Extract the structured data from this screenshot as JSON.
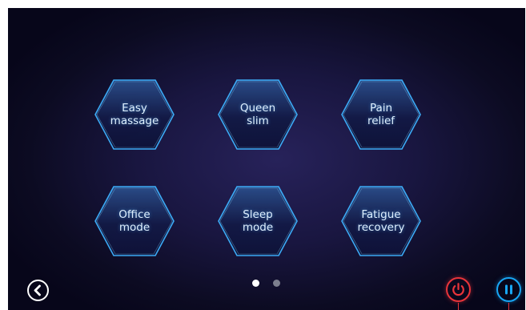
{
  "modes": [
    {
      "id": "easy-massage",
      "label": "Easy\nmassage"
    },
    {
      "id": "queen-slim",
      "label": "Queen\nslim"
    },
    {
      "id": "pain-relief",
      "label": "Pain\nrelief"
    },
    {
      "id": "office-mode",
      "label": "Office\nmode"
    },
    {
      "id": "sleep-mode",
      "label": "Sleep\nmode"
    },
    {
      "id": "fatigue-recovery",
      "label": "Fatigue\nrecovery"
    }
  ],
  "pagination": {
    "pages": 2,
    "current": 1
  },
  "icons": {
    "back": "chevron-left-icon",
    "power": "power-icon",
    "pause": "pause-icon"
  },
  "colors": {
    "accent": "#3fb3ff",
    "power": "#e8343a",
    "pause": "#18a6f5",
    "active_dot": "#ffffff",
    "inactive_dot": "#7c7f8e"
  }
}
